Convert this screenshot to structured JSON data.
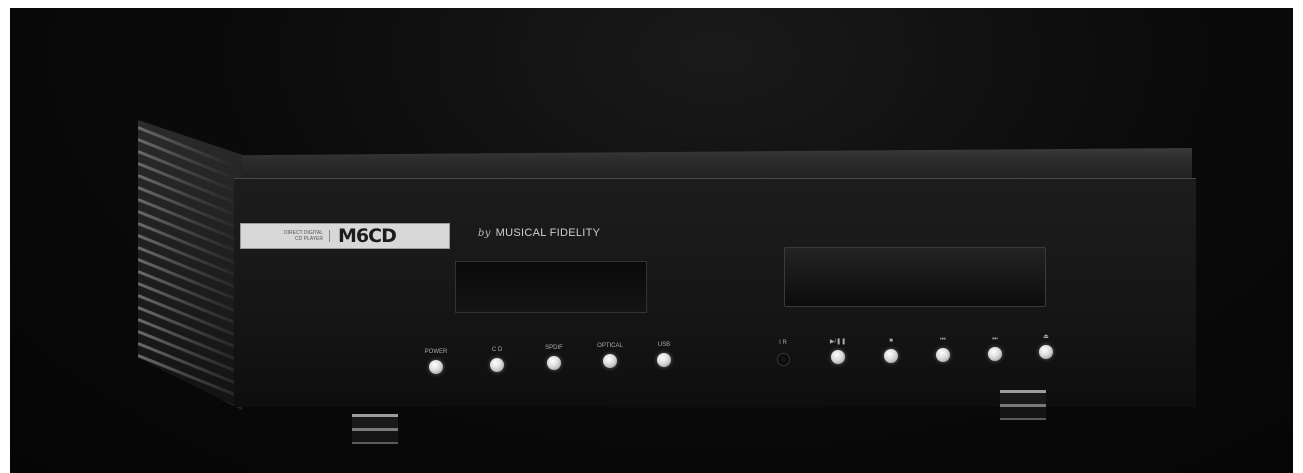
{
  "product": {
    "badge_subtitle": "DIRECT DIGITAL\nCD PLAYER",
    "model": "M6CD",
    "brand_prefix": "by",
    "brand_name": "MUSICAL FIDELITY"
  },
  "controls": [
    {
      "label": "POWER",
      "kind": "button"
    },
    {
      "label": "C D",
      "kind": "button"
    },
    {
      "label": "SPDIF",
      "kind": "button"
    },
    {
      "label": "OPTICAL",
      "kind": "button"
    },
    {
      "label": "USB",
      "kind": "button"
    },
    {
      "label": "I R",
      "kind": "sensor"
    },
    {
      "label": "▶/❚❚",
      "kind": "button"
    },
    {
      "label": "■",
      "kind": "button"
    },
    {
      "label": "⏮",
      "kind": "button"
    },
    {
      "label": "⏭",
      "kind": "button"
    },
    {
      "label": "⏏",
      "kind": "button"
    }
  ],
  "colors": {
    "background": "#0b0b0b",
    "panel": "#171717",
    "badge": "#d8d8d8",
    "button_glow": "#ffffff"
  }
}
